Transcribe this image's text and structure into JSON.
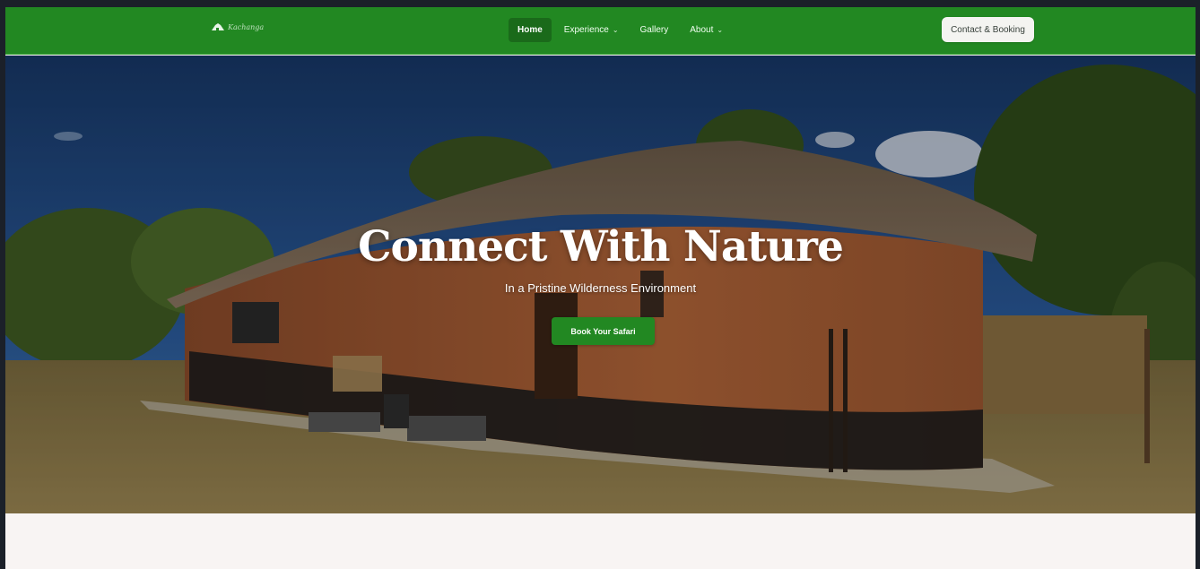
{
  "nav": {
    "logo_text": "Kachanga",
    "logo_icon": "thatched-hut-logo-icon",
    "menu": [
      {
        "label": "Home",
        "active": true,
        "dropdown": false
      },
      {
        "label": "Experience",
        "active": false,
        "dropdown": true
      },
      {
        "label": "Gallery",
        "active": false,
        "dropdown": false
      },
      {
        "label": "About",
        "active": false,
        "dropdown": true
      }
    ],
    "cta_label": "Contact & Booking"
  },
  "hero": {
    "title": "Connect With Nature",
    "subtitle": "In a Pristine Wilderness Environment",
    "button_label": "Book Your Safari"
  },
  "colors": {
    "brand_green": "#228822",
    "active_nav_bg": "#1a6a1a",
    "cta_bg": "#f4f4f1",
    "page_bg": "#f8f4f3"
  }
}
